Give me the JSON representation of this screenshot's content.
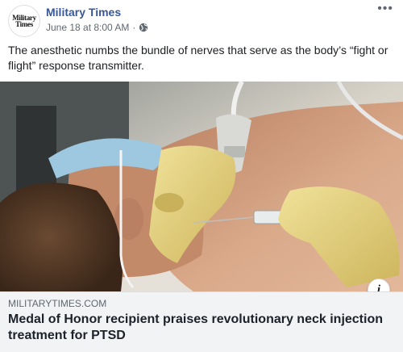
{
  "post": {
    "avatar_text": "Military Times",
    "page_name": "Military Times",
    "timestamp": "June 18 at 8:00 AM",
    "separator": "·",
    "privacy_icon": "globe-icon",
    "more_icon": "more-options-icon",
    "text": "The anesthetic numbs the bundle of nerves that serve as the body’s “fight or flight” response transmitter."
  },
  "link": {
    "domain": "MILITARYTIMES.COM",
    "headline": "Medal of Honor recipient praises revolutionary neck injection treatment for PTSD",
    "info_icon": "info-icon",
    "info_glyph": "i"
  },
  "colors": {
    "page_name": "#385898",
    "meta": "#616770",
    "link_box_bg": "#f2f3f5",
    "glove": "#e6d27a",
    "skin": "#c8987a",
    "mask": "#9ec7e0"
  }
}
